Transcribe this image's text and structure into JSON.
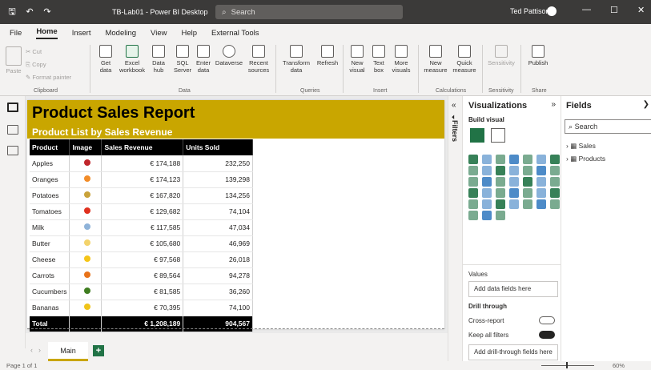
{
  "window": {
    "title": "TB-Lab01 - Power BI Desktop",
    "search_placeholder": "Search",
    "user": "Ted Pattison"
  },
  "menu": {
    "items": [
      "File",
      "Home",
      "Insert",
      "Modeling",
      "View",
      "Help",
      "External Tools"
    ],
    "active": "Home"
  },
  "ribbon": {
    "clipboard": {
      "paste": "Paste",
      "cut": "Cut",
      "copy": "Copy",
      "format_painter": "Format painter",
      "label": "Clipboard"
    },
    "data": {
      "get_data": "Get data",
      "excel": "Excel workbook",
      "data_hub": "Data hub",
      "sql": "SQL Server",
      "enter": "Enter data",
      "dataverse": "Dataverse",
      "recent": "Recent sources",
      "label": "Data"
    },
    "queries": {
      "transform": "Transform data",
      "refresh": "Refresh",
      "label": "Queries"
    },
    "insert": {
      "new_visual": "New visual",
      "text_box": "Text box",
      "more": "More visuals",
      "label": "Insert"
    },
    "calculations": {
      "new_measure": "New measure",
      "quick": "Quick measure",
      "label": "Calculations"
    },
    "sensitivity": {
      "btn": "Sensitivity",
      "label": "Sensitivity"
    },
    "share": {
      "publish": "Publish",
      "label": "Share"
    }
  },
  "report": {
    "title": "Product Sales Report",
    "subtitle": "Product List by Sales Revenue",
    "columns": [
      "Product",
      "Image",
      "Sales Revenue",
      "Units Sold"
    ],
    "rows": [
      {
        "product": "Apples",
        "revenue": "€ 174,188",
        "units": "232,250",
        "color": "#c0262c"
      },
      {
        "product": "Oranges",
        "revenue": "€ 174,123",
        "units": "139,298",
        "color": "#f28c28"
      },
      {
        "product": "Potatoes",
        "revenue": "€ 167,820",
        "units": "134,256",
        "color": "#c9a23a"
      },
      {
        "product": "Tomatoes",
        "revenue": "€ 129,682",
        "units": "74,104",
        "color": "#e0301e"
      },
      {
        "product": "Milk",
        "revenue": "€ 117,585",
        "units": "47,034",
        "color": "#8fb3d9"
      },
      {
        "product": "Butter",
        "revenue": "€ 105,680",
        "units": "46,969",
        "color": "#f3d36b"
      },
      {
        "product": "Cheese",
        "revenue": "€ 97,568",
        "units": "26,018",
        "color": "#f5c518"
      },
      {
        "product": "Carrots",
        "revenue": "€ 89,564",
        "units": "94,278",
        "color": "#e8731a"
      },
      {
        "product": "Cucumbers",
        "revenue": "€ 81,585",
        "units": "36,260",
        "color": "#3f7d20"
      },
      {
        "product": "Bananas",
        "revenue": "€ 70,395",
        "units": "74,100",
        "color": "#f0c419"
      }
    ],
    "total": {
      "label": "Total",
      "revenue": "€ 1,208,189",
      "units": "904,567"
    }
  },
  "filters": {
    "label": "Filters"
  },
  "visualizations": {
    "title": "Visualizations",
    "build": "Build visual",
    "values": "Values",
    "values_placeholder": "Add data fields here",
    "drill": "Drill through",
    "cross_report": "Cross-report",
    "keep_filters": "Keep all filters",
    "drill_placeholder": "Add drill-through fields here",
    "toggle_off": "Off",
    "toggle_on": "On"
  },
  "fields": {
    "title": "Fields",
    "search_placeholder": "Search",
    "tables": [
      "Sales",
      "Products"
    ]
  },
  "pages": {
    "main": "Main"
  },
  "status": {
    "page": "Page 1 of 1",
    "zoom": "60%"
  }
}
